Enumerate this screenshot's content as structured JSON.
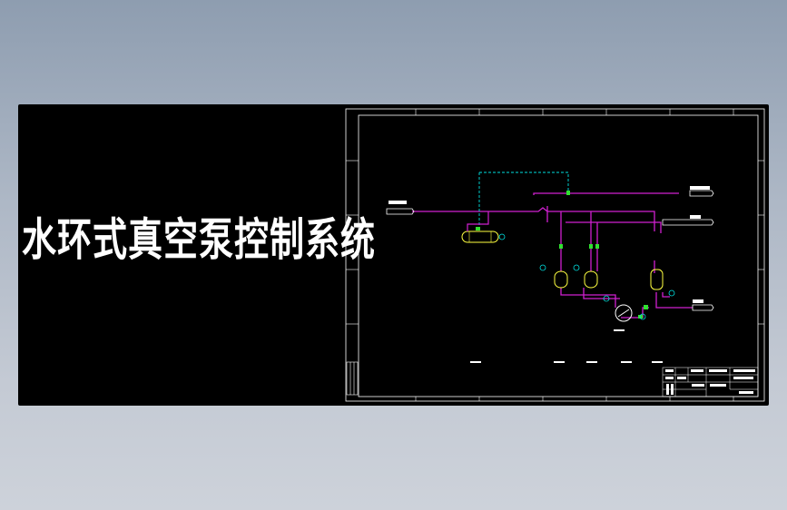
{
  "title": "水环式真空泵控制系统",
  "colors": {
    "background": "#000000",
    "frame": "#ffffff",
    "process_line": "#d020d0",
    "signal_line": "#00e0e0",
    "valve": "#30e030",
    "equipment": "#ffff40"
  },
  "drawing": {
    "icons": [
      "heat-exchanger-icon",
      "pump-icon",
      "separator-tank-icon",
      "valve-icon",
      "instrument-bubble-icon"
    ]
  }
}
